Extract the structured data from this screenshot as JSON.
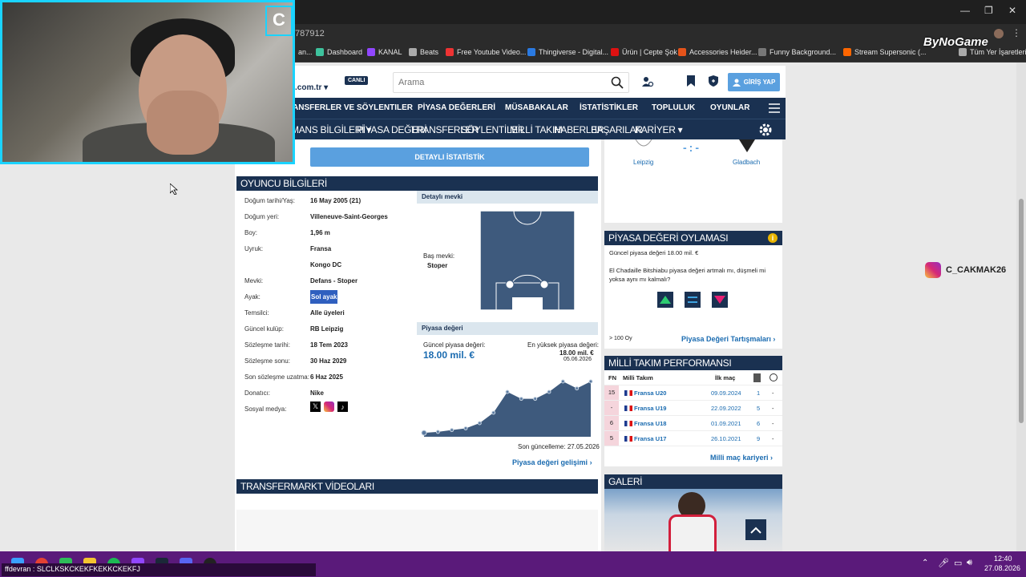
{
  "browser": {
    "url_fragment": "787912",
    "bookmarks": [
      {
        "label": "an...",
        "color": "#888"
      },
      {
        "label": "Dashboard",
        "color": "#3ec29d"
      },
      {
        "label": "KANAL",
        "color": "#9146ff"
      },
      {
        "label": "Beats",
        "color": "#aaa"
      },
      {
        "label": "Free Youtube Video...",
        "color": "#e33"
      },
      {
        "label": "Thingiverse - Digital...",
        "color": "#2a7ae2"
      },
      {
        "label": "Ürün | Cepte Şok",
        "color": "#d11"
      },
      {
        "label": "Accessories Heider...",
        "color": "#e5531a"
      },
      {
        "label": "Funny Background...",
        "color": "#777"
      },
      {
        "label": "Stream Supersonic (...",
        "color": "#f60"
      },
      {
        "label": "Tüm Yer İşaretleri",
        "color": "#aaa"
      }
    ]
  },
  "overlay": {
    "brand": "ByNoGame",
    "instagram_handle": "C_CAKMAK26",
    "webcam_logo": "C"
  },
  "header": {
    "logo_text": ".com.tr",
    "live_badge": "CANLI",
    "search_placeholder": "Arama",
    "login_label": "GİRİŞ YAP"
  },
  "mainnav": [
    "ANSFERLER VE SÖYLENTILER",
    "PİYASA DEĞERLERİ",
    "MÜSABAKALAR",
    "İSTATİSTİKLER",
    "TOPLULUK",
    "OYUNLAR"
  ],
  "subnav": [
    "MANS BİLGİLERİ ▾",
    "PİYASA DEĞERİ",
    "TRANSFERLER",
    "SÖYLENTİLER",
    "MİLLİ TAKIM",
    "HABERLER",
    "BAŞARILAR",
    "KARİYER ▾"
  ],
  "detail_button": "DETAYLI İSTATİSTİK",
  "player_info": {
    "title": "OYUNCU BİLGİLERİ",
    "rows": [
      {
        "label": "Doğum tarihi/Yaş:",
        "value": "16 May 2005 (21)"
      },
      {
        "label": "Doğum yeri:",
        "value": "Villeneuve-Saint-Georges"
      },
      {
        "label": "Boy:",
        "value": "1,96 m"
      },
      {
        "label": "Uyruk:",
        "value": "Fransa"
      },
      {
        "label": "",
        "value": "Kongo DC"
      },
      {
        "label": "Mevki:",
        "value": "Defans - Stoper"
      },
      {
        "label": "Ayak:",
        "value": "Sol ayak"
      },
      {
        "label": "Temsilci:",
        "value": "Alle üyeleri"
      },
      {
        "label": "Güncel kulüp:",
        "value": "RB Leipzig"
      },
      {
        "label": "Sözleşme tarihi:",
        "value": "18 Tem 2023"
      },
      {
        "label": "Sözleşme sonu:",
        "value": "30 Haz 2029"
      },
      {
        "label": "Son sözleşme uzatma:",
        "value": "6 Haz 2025"
      },
      {
        "label": "Donatıcı:",
        "value": "Nike"
      },
      {
        "label": "Sosyal medya:",
        "value": ""
      }
    ],
    "position_title": "Detaylı mevki",
    "main_position_label": "Baş mevki:",
    "main_position_value": "Stoper",
    "market_title": "Piyasa değeri",
    "current_label": "Güncel piyasa değeri:",
    "current_value": "18.00 mil. €",
    "highest_label": "En yüksek piyasa değeri:",
    "highest_value": "18.00 mil. €",
    "highest_date": "05.06.2026",
    "last_update": "Son güncelleme: 27.05.2026",
    "market_link": "Piyasa değeri gelişimi"
  },
  "chart_data": {
    "type": "area",
    "values": [
      0.2,
      0.5,
      1.0,
      1.5,
      3.0,
      6.0,
      12.0,
      10.0,
      10.0,
      12.0,
      15.0,
      13.0,
      15.0
    ],
    "ylim": [
      0,
      18
    ],
    "color": "#3e5a7d"
  },
  "videos_title": "TRANSFERMARKT VİDEOLARI",
  "match": {
    "home": "Leipzig",
    "away": "Gladbach",
    "score": "-:-"
  },
  "vote": {
    "title": "PİYASA DEĞERİ OYLAMASI",
    "current": "Güncel piyasa değeri 18.00 mil. €",
    "question": "El Chadaille Bitshiabu piyasa değeri artmalı mı, düşmeli mi yoksa aynı mı kalmalı?",
    "count": "> 100 Oy",
    "link": "Piyasa Değeri Tartışmaları"
  },
  "national": {
    "title": "MİLLİ TAKIM PERFORMANSI",
    "headers": [
      "FN",
      "Milli Takım",
      "İlk maç"
    ],
    "rows": [
      {
        "fn": "15",
        "team": "Fransa U20",
        "date": "09.09.2024",
        "apps": "1",
        "goals": "-"
      },
      {
        "fn": "-",
        "team": "Fransa U19",
        "date": "22.09.2022",
        "apps": "5",
        "goals": "-"
      },
      {
        "fn": "6",
        "team": "Fransa U18",
        "date": "01.09.2021",
        "apps": "6",
        "goals": "-"
      },
      {
        "fn": "5",
        "team": "Fransa U17",
        "date": "26.10.2021",
        "apps": "9",
        "goals": "-"
      }
    ],
    "link": "Milli maç kariyeri"
  },
  "gallery_title": "GALERİ",
  "taskbar": {
    "chat": "ffdevran : SLCLKSKCKEKFKEKKCKEKFJ",
    "time": "12:40",
    "date": "27.08.2026"
  }
}
